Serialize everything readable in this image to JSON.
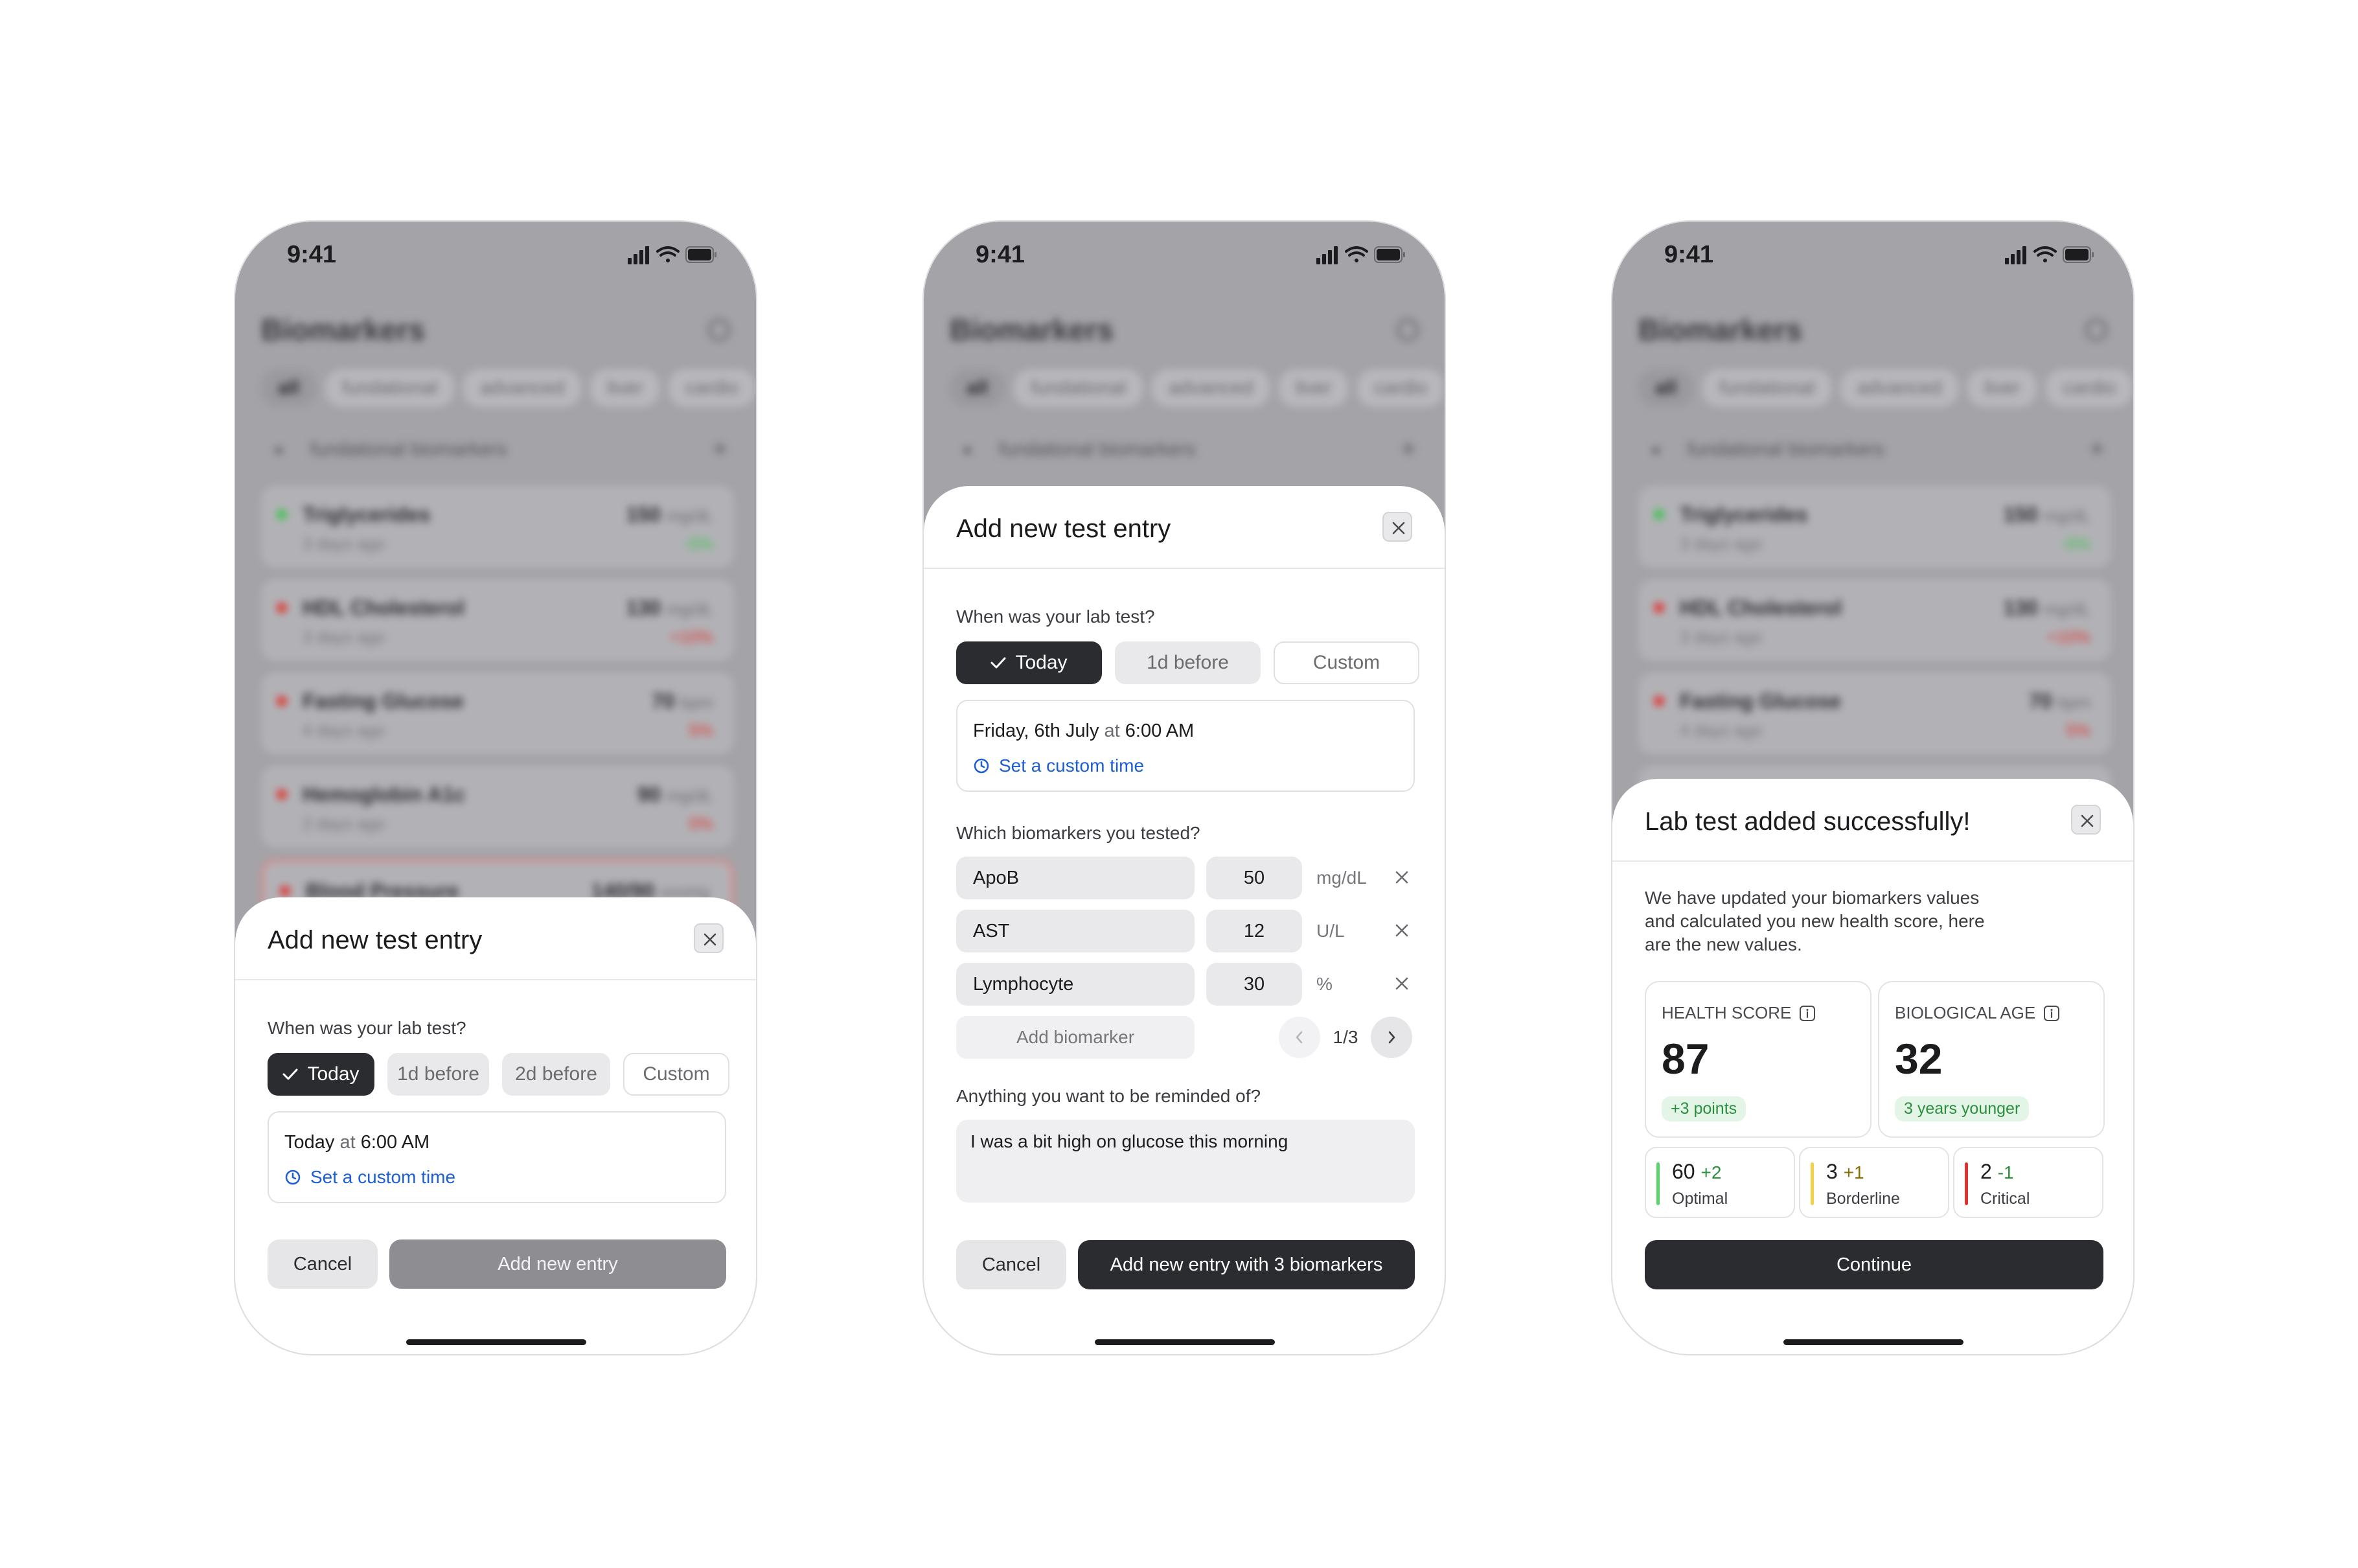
{
  "status_bar": {
    "time": "9:41"
  },
  "background": {
    "title": "Biomarkers",
    "chips": [
      "all",
      "fundational",
      "advanced",
      "liver",
      "cardio"
    ],
    "section": "fundational biomarkers",
    "cards": [
      {
        "name": "Triglycerides",
        "sub": "3 days ago",
        "value": "150",
        "unit": "mg/dL",
        "change": "-5%",
        "status": "green"
      },
      {
        "name": "HDL Cholesterol",
        "sub": "3 days ago",
        "value": "130",
        "unit": "mg/dL",
        "change": "+10%",
        "status": "red"
      },
      {
        "name": "Fasting Glucose",
        "sub": "4 days ago",
        "value": "70",
        "unit": "bpm",
        "change": "5%",
        "status": "red"
      },
      {
        "name": "Hemoglobin A1c",
        "sub": "2 days ago",
        "value": "90",
        "unit": "mg/dL",
        "change": "0%",
        "status": "red"
      },
      {
        "name": "Blood Pressure",
        "sub": "",
        "value": "140/90",
        "unit": "mmHg",
        "change": "",
        "status": "red"
      }
    ]
  },
  "screen1": {
    "title": "Add new test entry",
    "question": "When was your lab test?",
    "options": [
      "Today",
      "1d before",
      "2d before",
      "Custom"
    ],
    "date_main": "Today",
    "date_at": "at",
    "date_time": "6:00 AM",
    "custom_link": "Set a custom time",
    "cancel": "Cancel",
    "submit": "Add new entry"
  },
  "screen2": {
    "title": "Add new test entry",
    "question": "When was your lab test?",
    "options": [
      "Today",
      "1d before",
      "Custom"
    ],
    "date_main": "Friday, 6th July",
    "date_at": "at",
    "date_time": "6:00 AM",
    "custom_link": "Set a custom time",
    "biomarkers_question": "Which biomarkers you tested?",
    "biomarkers": [
      {
        "name": "ApoB",
        "value": "50",
        "unit": "mg/dL"
      },
      {
        "name": "AST",
        "value": "12",
        "unit": "U/L"
      },
      {
        "name": "Lymphocyte",
        "value": "30",
        "unit": "%"
      }
    ],
    "add_biomarker": "Add biomarker",
    "page": "1/3",
    "reminder_question": "Anything you want to be reminded of?",
    "reminder_value": "I was a bit high on glucose this morning",
    "cancel": "Cancel",
    "submit": "Add new entry with 3 biomarkers"
  },
  "screen3": {
    "title": "Lab test added successfully!",
    "description": "We have updated your biomarkers values and calculated you new health score, here are the new values.",
    "health_score": {
      "label": "HEALTH SCORE",
      "value": "87",
      "badge": "+3 points"
    },
    "bio_age": {
      "label": "BIOLOGICAL AGE",
      "value": "32",
      "badge": "3 years younger"
    },
    "counts": [
      {
        "num": "60",
        "delta": "+2",
        "label": "Optimal",
        "color": "#59d36b",
        "delta_color": "#2c8f3e"
      },
      {
        "num": "3",
        "delta": "+1",
        "label": "Borderline",
        "color": "#f2d14b",
        "delta_color": "#8a6d00"
      },
      {
        "num": "2",
        "delta": "-1",
        "label": "Critical",
        "color": "#e0332f",
        "delta_color": "#2c8f3e"
      }
    ],
    "continue": "Continue"
  },
  "colors": {
    "primary": "#2b2c30",
    "link": "#1c5fd4",
    "positive": "#2c8f3e"
  }
}
